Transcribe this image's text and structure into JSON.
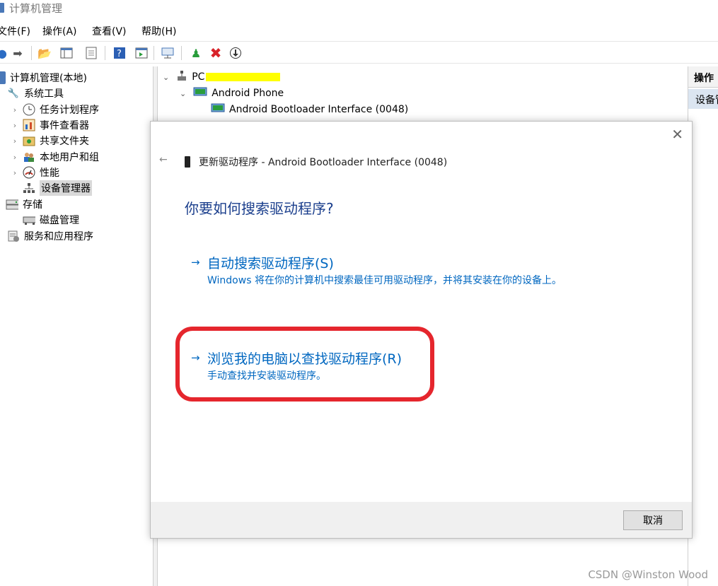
{
  "window": {
    "title": "计算机管理"
  },
  "menu": [
    "文件(F)",
    "操作(A)",
    "查看(V)",
    "帮助(H)"
  ],
  "tree": {
    "root": "计算机管理(本地)",
    "system_tools": "系统工具",
    "task_scheduler": "任务计划程序",
    "event_viewer": "事件查看器",
    "shared_folders": "共享文件夹",
    "local_users": "本地用户和组",
    "performance": "性能",
    "device_manager": "设备管理器",
    "storage": "存储",
    "disk_management": "磁盘管理",
    "services_apps": "服务和应用程序"
  },
  "devices": {
    "computer": "PC",
    "android_phone": "Android Phone",
    "bootloader": "Android Bootloader Interface (0048)"
  },
  "actions": {
    "header": "操作",
    "item": "设备管理器"
  },
  "dialog": {
    "title": "更新驱动程序 - Android Bootloader Interface (0048)",
    "question": "你要如何搜索驱动程序?",
    "option_auto": {
      "arrow": "→",
      "label": "自动搜索驱动程序(S)",
      "desc": "Windows 将在你的计算机中搜索最佳可用驱动程序，并将其安装在你的设备上。"
    },
    "option_browse": {
      "arrow": "→",
      "label": "浏览我的电脑以查找驱动程序(R)",
      "desc": "手动查找并安装驱动程序。"
    },
    "cancel": "取消"
  },
  "watermark": "CSDN @Winston Wood",
  "colors": {
    "link": "#0067c0",
    "question": "#1a3e8c",
    "highlight": "#e5262d",
    "selection": "#dbe5f1"
  }
}
